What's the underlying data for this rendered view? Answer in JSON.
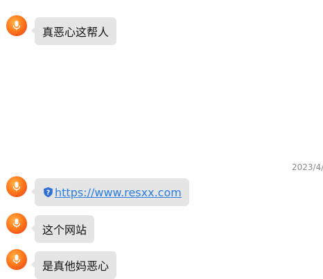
{
  "messages": [
    {
      "text": "真恶心这帮人"
    },
    {
      "text": "https://www.resxx.com",
      "is_link": true
    },
    {
      "text": "这个网站"
    },
    {
      "text": "是真他妈恶心"
    }
  ],
  "timestamp": "2023/4/",
  "colors": {
    "bubble": "#e5e5e5",
    "link": "#2a7de1",
    "avatar": "#ff7a1a"
  },
  "icons": {
    "avatar": "microphone-icon",
    "link_badge": "shield-check-icon"
  }
}
